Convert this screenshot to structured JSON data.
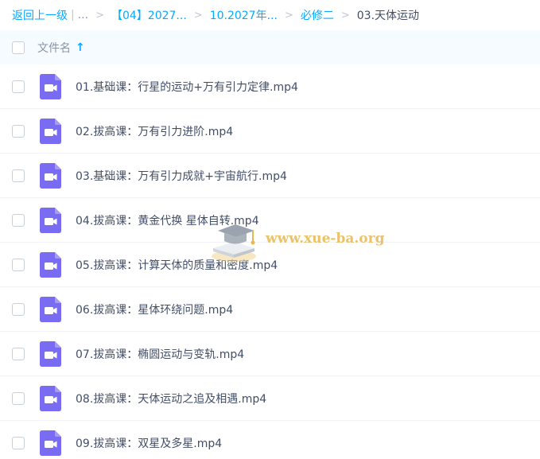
{
  "breadcrumb": {
    "back": "返回上一级",
    "sep": "|",
    "ellipsis": "...",
    "items": [
      "【04】2027...",
      "10.2027年...",
      "必修二"
    ],
    "current": "03.天体运动"
  },
  "header": {
    "column_name": "文件名",
    "sort_icon": "sort-ascending-arrow-icon"
  },
  "files": [
    {
      "name": "01.基础课：行星的运动+万有引力定律.mp4"
    },
    {
      "name": "02.拔高课：万有引力进阶.mp4"
    },
    {
      "name": "03.基础课：万有引力成就+宇宙航行.mp4"
    },
    {
      "name": "04.拔高课：黄金代换 星体自转.mp4"
    },
    {
      "name": "05.拔高课：计算天体的质量和密度.mp4"
    },
    {
      "name": "06.拔高课：星体环绕问题.mp4"
    },
    {
      "name": "07.拔高课：椭圆运动与变轨.mp4"
    },
    {
      "name": "08.拔高课：天体运动之追及相遇.mp4"
    },
    {
      "name": "09.拔高课：双星及多星.mp4"
    }
  ],
  "file_icon": "video-file-icon",
  "watermark": {
    "text": "www.xue-ba.org",
    "icon": "graduation-cap-book-logo"
  },
  "colors": {
    "link": "#09aaff",
    "icon": "#7a6cf2",
    "header_bg": "#f5fbff"
  }
}
